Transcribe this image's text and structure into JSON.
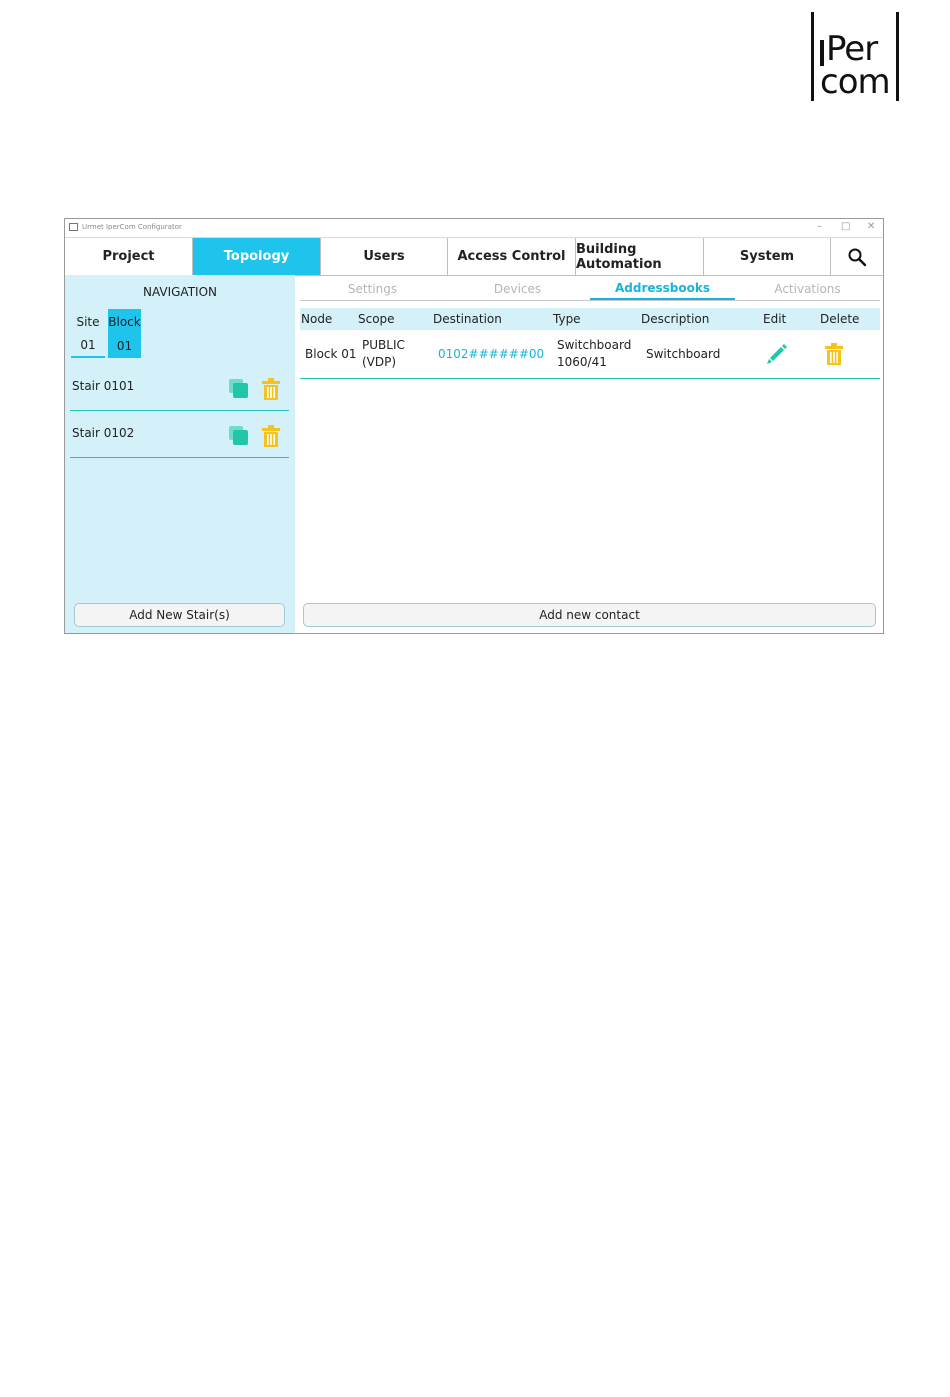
{
  "logo": {
    "line1": "Per",
    "line2": "com"
  },
  "window": {
    "title": "Urmet IperCom Configurator",
    "controls": {
      "minimize": "–",
      "maximize": "□",
      "close": "✕"
    }
  },
  "menu": {
    "items": [
      {
        "label": "Project",
        "active": false
      },
      {
        "label": "Topology",
        "active": true
      },
      {
        "label": "Users",
        "active": false
      },
      {
        "label": "Access Control",
        "active": false
      },
      {
        "label": "Building Automation",
        "active": false
      },
      {
        "label": "System",
        "active": false
      }
    ],
    "search_icon": "search-icon"
  },
  "navigation": {
    "title": "NAVIGATION",
    "tabs": [
      {
        "label": "Site",
        "value": "01",
        "active": false
      },
      {
        "label": "Block",
        "value": "01",
        "active": true
      }
    ],
    "stairs": [
      {
        "label": "Stair 0101"
      },
      {
        "label": "Stair 0102"
      }
    ],
    "add_button": "Add New Stair(s)"
  },
  "subtabs": [
    {
      "label": "Settings",
      "active": false
    },
    {
      "label": "Devices",
      "active": false
    },
    {
      "label": "Addressbooks",
      "active": true
    },
    {
      "label": "Activations",
      "active": false
    }
  ],
  "table": {
    "headers": [
      "Node",
      "Scope",
      "Destination",
      "Type",
      "Description",
      "Edit",
      "Delete"
    ],
    "rows": [
      {
        "node": "Block 01",
        "scope_line1": "PUBLIC",
        "scope_line2": "(VDP)",
        "destination": "0102######00",
        "type_line1": "Switchboard",
        "type_line2": "1060/41",
        "description": "Switchboard"
      }
    ]
  },
  "add_contact_button": "Add new contact",
  "colors": {
    "accent": "#1ec4eb",
    "panel_bg": "#d4f1f9",
    "divider": "#23c6b6",
    "edit_icon": "#1fc7a8",
    "delete_icon": "#f7c21c",
    "copy_icon": "#1fc7a8"
  }
}
